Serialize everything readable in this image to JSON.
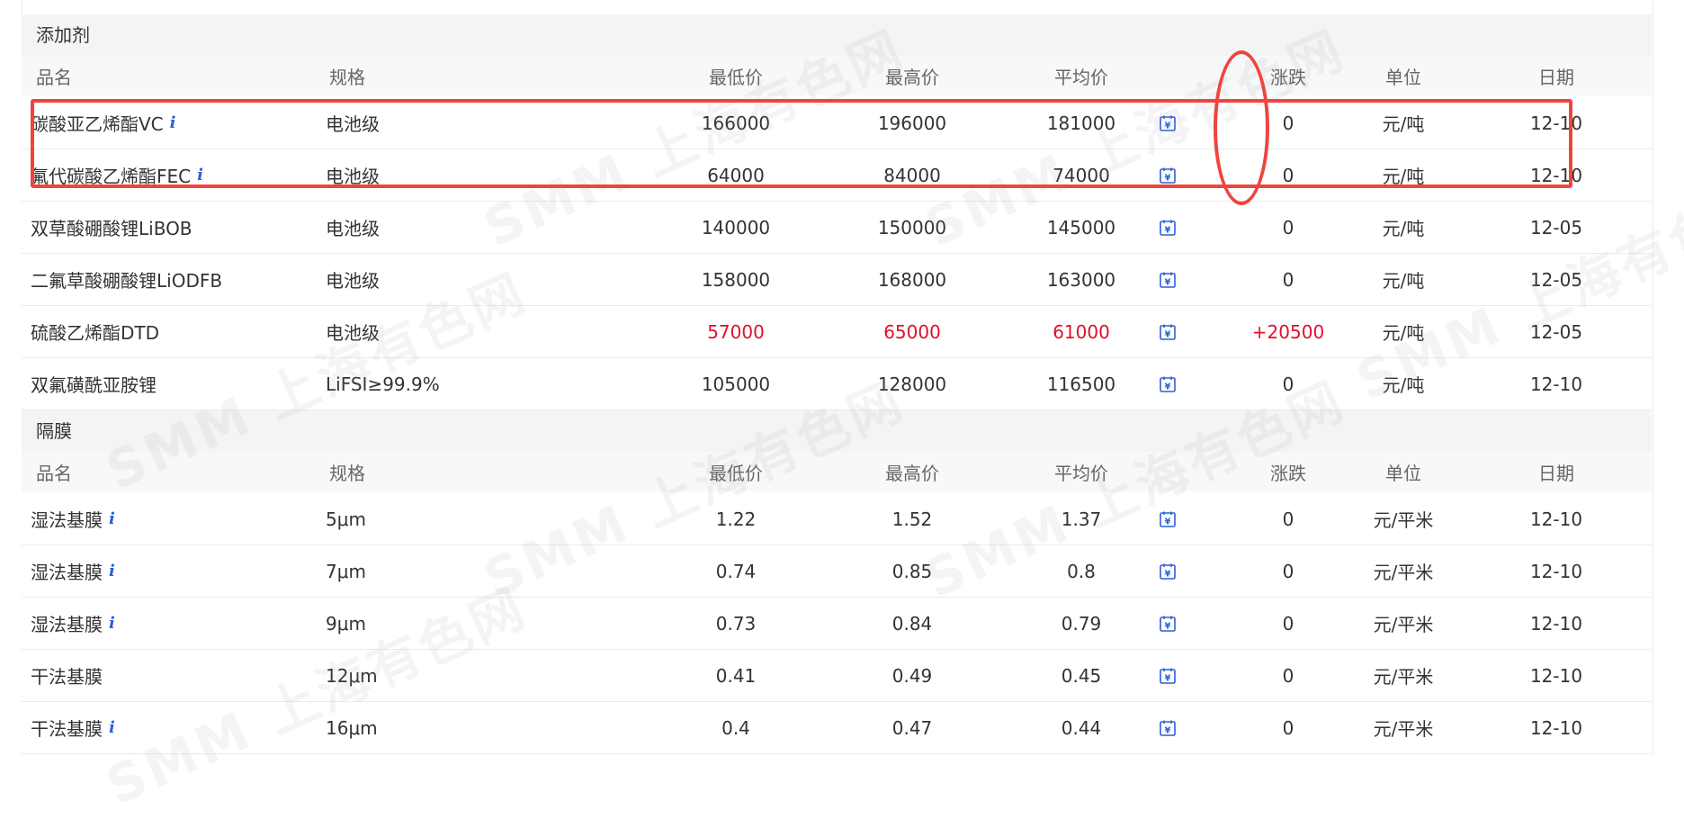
{
  "column_headers": {
    "name": "品名",
    "spec": "规格",
    "low": "最低价",
    "high": "最高价",
    "avg": "平均价",
    "change": "涨跌",
    "unit": "单位",
    "date": "日期"
  },
  "sections": [
    {
      "title": "添加剂",
      "rows": [
        {
          "name": "碳酸亚乙烯酯VC",
          "info": "i",
          "spec": "电池级",
          "low": "166000",
          "high": "196000",
          "avg": "181000",
          "change": "0",
          "unit": "元/吨",
          "date": "12-10",
          "rising": false
        },
        {
          "name": "氟代碳酸乙烯酯FEC",
          "info": "i",
          "spec": "电池级",
          "low": "64000",
          "high": "84000",
          "avg": "74000",
          "change": "0",
          "unit": "元/吨",
          "date": "12-10",
          "rising": false
        },
        {
          "name": "双草酸硼酸锂LiBOB",
          "info": "",
          "spec": "电池级",
          "low": "140000",
          "high": "150000",
          "avg": "145000",
          "change": "0",
          "unit": "元/吨",
          "date": "12-05",
          "rising": false
        },
        {
          "name": "二氟草酸硼酸锂LiODFB",
          "info": "",
          "spec": "电池级",
          "low": "158000",
          "high": "168000",
          "avg": "163000",
          "change": "0",
          "unit": "元/吨",
          "date": "12-05",
          "rising": false
        },
        {
          "name": "硫酸乙烯酯DTD",
          "info": "",
          "spec": "电池级",
          "low": "57000",
          "high": "65000",
          "avg": "61000",
          "change": "+20500",
          "unit": "元/吨",
          "date": "12-05",
          "rising": true
        },
        {
          "name": "双氟磺酰亚胺锂",
          "info": "",
          "spec": "LiFSI≥99.9%",
          "low": "105000",
          "high": "128000",
          "avg": "116500",
          "change": "0",
          "unit": "元/吨",
          "date": "12-10",
          "rising": false
        }
      ]
    },
    {
      "title": "隔膜",
      "rows": [
        {
          "name": "湿法基膜",
          "info": "i",
          "spec": "5μm",
          "low": "1.22",
          "high": "1.52",
          "avg": "1.37",
          "change": "0",
          "unit": "元/平米",
          "date": "12-10",
          "rising": false
        },
        {
          "name": "湿法基膜",
          "info": "i",
          "spec": "7μm",
          "low": "0.74",
          "high": "0.85",
          "avg": "0.8",
          "change": "0",
          "unit": "元/平米",
          "date": "12-10",
          "rising": false
        },
        {
          "name": "湿法基膜",
          "info": "i",
          "spec": "9μm",
          "low": "0.73",
          "high": "0.84",
          "avg": "0.79",
          "change": "0",
          "unit": "元/平米",
          "date": "12-10",
          "rising": false
        },
        {
          "name": "干法基膜",
          "info": "",
          "spec": "12μm",
          "low": "0.41",
          "high": "0.49",
          "avg": "0.45",
          "change": "0",
          "unit": "元/平米",
          "date": "12-10",
          "rising": false
        },
        {
          "name": "干法基膜",
          "info": "i",
          "spec": "16μm",
          "low": "0.4",
          "high": "0.47",
          "avg": "0.44",
          "change": "0",
          "unit": "元/平米",
          "date": "12-10",
          "rising": false
        }
      ]
    }
  ],
  "watermark": "SMM 上海有色网",
  "icons": {
    "chart": "calendar-chart-icon",
    "info": "info-icon"
  },
  "colors": {
    "rise": "#e0102b",
    "icon": "#2b5fd9",
    "annotation": "#f0443f"
  }
}
